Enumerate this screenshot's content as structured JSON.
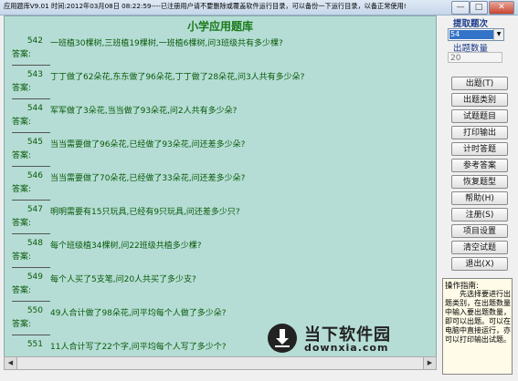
{
  "window": {
    "title": "应用题库V9.01  时间:2012年03月08日 08:22:59----已注册用户请不要删除或覆盖软件运行目录，可以备份一下运行目录，以备正常使用!",
    "min": "—",
    "max": "□",
    "close": "✕"
  },
  "main": {
    "title": "小学应用题库",
    "answer_label": "答案:",
    "questions": [
      {
        "num": "542",
        "text": "一班植30棵树,三班植19棵树,一班植6棵树,问3班级共有多少棵?"
      },
      {
        "num": "543",
        "text": "丁丁做了62朵花,东东做了96朵花,丁丁做了28朵花,问3人共有多少朵?"
      },
      {
        "num": "544",
        "text": "军军做了3朵花,当当做了93朵花,问2人共有多少朵?"
      },
      {
        "num": "545",
        "text": "当当需要做了96朵花,已经做了93朵花,问还差多少朵?"
      },
      {
        "num": "546",
        "text": "当当需要做了70朵花,已经做了33朵花,问还差多少朵?"
      },
      {
        "num": "547",
        "text": "明明需要有15只玩具,已经有9只玩具,问还差多少只?"
      },
      {
        "num": "548",
        "text": "每个班级植34棵树,问22班级共植多少棵?"
      },
      {
        "num": "549",
        "text": "每个人买了5支笔,问20人共买了多少支?"
      },
      {
        "num": "550",
        "text": "49人合计做了98朵花,问平均每个人做了多少朵?"
      },
      {
        "num": "551",
        "text": "11人合计写了22个字,问平均每个人写了多少个?"
      }
    ]
  },
  "sidebar": {
    "pick_label": "提取题次",
    "pick_value": "54",
    "count_label": "出题数量",
    "count_value": "20",
    "buttons": [
      "出题(T)",
      "出题类别",
      "试题题目",
      "打印输出",
      "计时答题",
      "参考答案",
      "恢复题型",
      "帮助(H)",
      "注册(S)",
      "项目设置",
      "清空试题",
      "退出(X)"
    ],
    "guide_title": "操作指南:",
    "guide_body": "先选择要进行出题类别，在出题数量中输入要出题数量，即可以出题。可以在电脑中直接运行，亦可以打印输出试题。"
  },
  "watermark": {
    "name": "当下软件园",
    "domain": "downxia.com"
  }
}
